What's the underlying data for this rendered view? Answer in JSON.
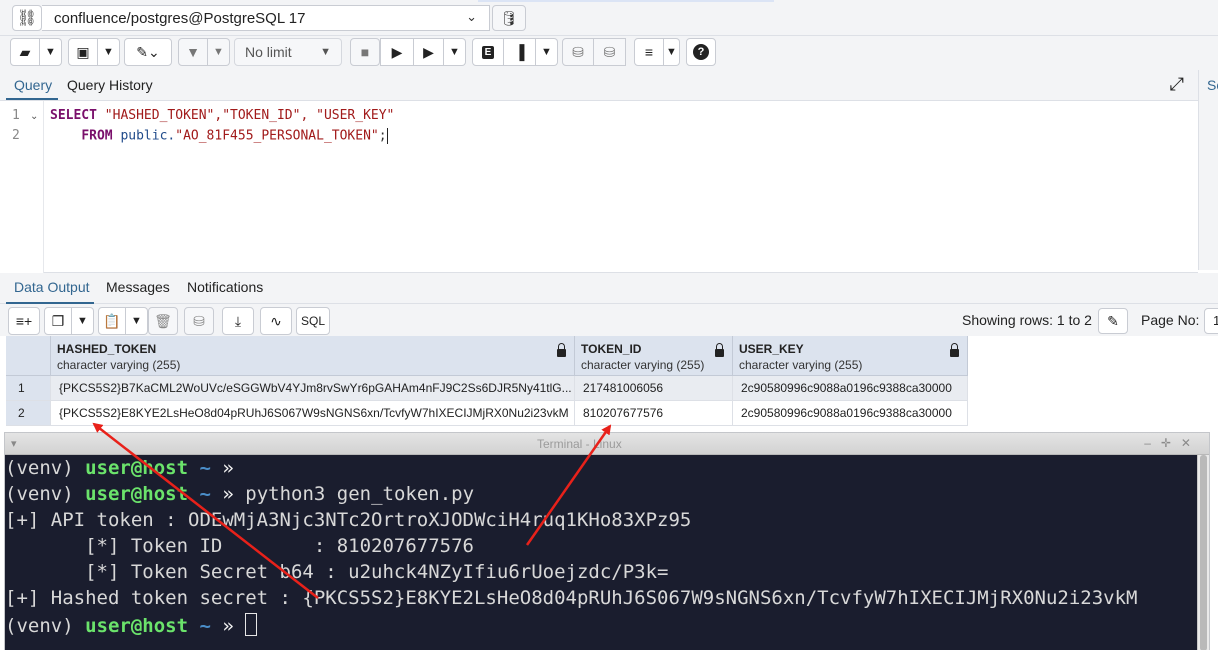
{
  "connection": {
    "label": "confluence/postgres@PostgreSQL 17"
  },
  "toolbar": {
    "limit": "No limit",
    "explain_label": "E",
    "lines_label": "≡"
  },
  "query_tabs": [
    {
      "label": "Query"
    },
    {
      "label": "Query History"
    }
  ],
  "side_panel": {
    "label": "Sc"
  },
  "editor": {
    "line_numbers": [
      "1",
      "2"
    ],
    "line1": {
      "kw": "SELECT",
      "cols": "\"HASHED_TOKEN\",\"TOKEN_ID\", \"USER_KEY\""
    },
    "line2": {
      "kw": "FROM",
      "schema": "public.",
      "table": "\"AO_81F455_PERSONAL_TOKEN\"",
      "end": ";"
    }
  },
  "output_tabs": [
    {
      "label": "Data Output"
    },
    {
      "label": "Messages"
    },
    {
      "label": "Notifications"
    }
  ],
  "output_toolbar": {
    "sql_label": "SQL",
    "showing": "Showing rows: 1 to 2",
    "page_label": "Page No:",
    "page_value": "1"
  },
  "grid": {
    "columns": [
      {
        "name": "HASHED_TOKEN",
        "type": "character varying (255)"
      },
      {
        "name": "TOKEN_ID",
        "type": "character varying (255)"
      },
      {
        "name": "USER_KEY",
        "type": "character varying (255)"
      }
    ],
    "rows": [
      {
        "num": "1",
        "hashed": "{PKCS5S2}B7KaCML2WoUVc/eSGGWbV4YJm8rvSwYr6pGAHAm4nFJ9C2Ss6DJR5Ny41tlG...",
        "token_id": "217481006056",
        "user_key": "2c90580996c9088a0196c9388ca30000"
      },
      {
        "num": "2",
        "hashed": "{PKCS5S2}E8KYE2LsHeO8d04pRUhJ6S067W9sNGNS6xn/TcvfyW7hIXECIJMjRX0Nu2i23vkM",
        "token_id": "810207677576",
        "user_key": "2c90580996c9088a0196c9388ca30000"
      }
    ]
  },
  "terminal": {
    "title": "Terminal - Linux",
    "prompt": {
      "venv": "(venv) ",
      "user": "user@host",
      "tilde": " ~ ",
      "arrow": "»"
    },
    "command": " python3 gen_token.py",
    "api_token_line": "[+] API token : ODEwMjA3Njc3NTc2OrtroXJODWciH4ruq1KHo83XPz95",
    "token_id_line": "       [*] Token ID        : 810207677576",
    "token_secret_line": "       [*] Token Secret b64 : u2uhck4NZyIfiu6rUoejzdc/P3k=",
    "hashed_line": "[+] Hashed token secret : {PKCS5S2}E8KYE2LsHeO8d04pRUhJ6S067W9sNGNS6xn/TcvfyW7hIXECIJMjRX0Nu2i23vkM"
  },
  "colors": {
    "accent": "#326690",
    "header_bg": "#dce3ee",
    "terminal_bg": "#1a1d2e",
    "prompt_green": "#6be36b",
    "arrow_red": "#e8211a"
  }
}
